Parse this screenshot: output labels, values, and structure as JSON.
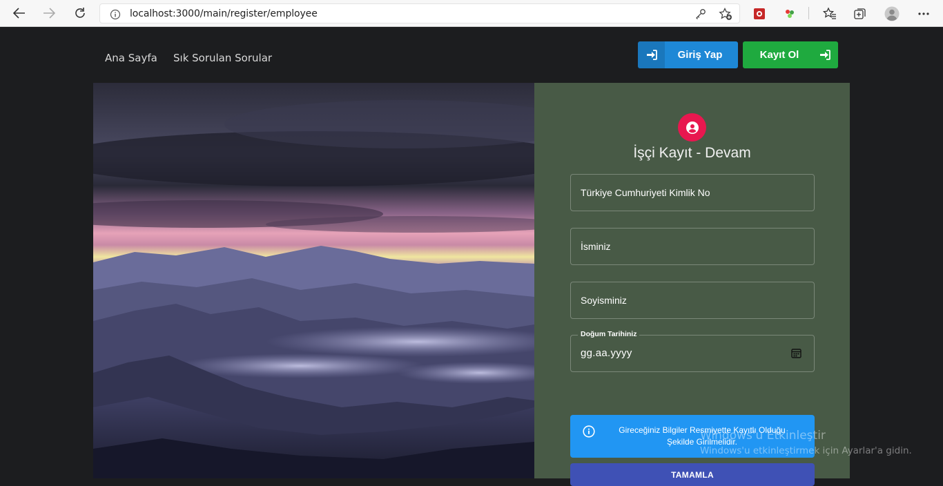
{
  "browser": {
    "url": "localhost:3000/main/register/employee"
  },
  "nav": {
    "links": [
      "Ana Sayfa",
      "Sık Sorulan Sorular"
    ],
    "login_label": "Giriş Yap",
    "register_label": "Kayıt Ol"
  },
  "form": {
    "title": "İşçi Kayıt - Devam",
    "fields": {
      "tc_placeholder": "Türkiye Cumhuriyeti Kimlik No",
      "name_placeholder": "İsminiz",
      "surname_placeholder": "Soyisminiz",
      "birth_label": "Doğum Tarihiniz",
      "birth_value": "gg.aa.yyyy"
    },
    "alert": "Gireceğiniz Bilgiler Resmiyette Kayıtlı Olduğu Şekilde Girilmelidir.",
    "submit_label": "TAMAMLA"
  },
  "watermark": {
    "title": "Windows'u Etkinleştir",
    "subtitle": "Windows'u etkinleştirmek için Ayarlar'a gidin."
  },
  "colors": {
    "login_button": "#1e88d6",
    "register_button": "#1faa3f",
    "panel_background": "#485a46",
    "avatar": "#e8174f",
    "alert": "#2196f3",
    "submit": "#3f51b5"
  },
  "icons": {
    "back": "arrow-left-icon",
    "forward": "arrow-right-icon",
    "refresh": "refresh-icon",
    "site_info": "info-icon",
    "key": "key-icon",
    "add_favorite": "star-plus-icon",
    "favorites": "favorites-icon",
    "collections": "collections-icon",
    "profile": "profile-icon",
    "menu": "more-icon",
    "login": "sign-in-icon",
    "avatar": "account-circle-icon",
    "calendar": "calendar-icon",
    "alert": "info-circle-icon"
  }
}
